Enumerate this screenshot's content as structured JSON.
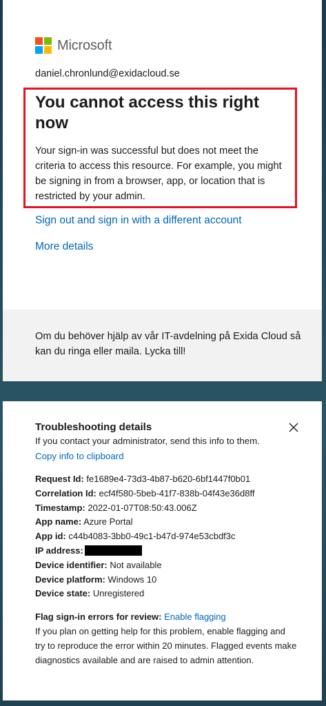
{
  "brand": {
    "name": "Microsoft",
    "colors": [
      "#f25022",
      "#7fba00",
      "#00a4ef",
      "#ffb900"
    ]
  },
  "signin": {
    "email": "daniel.chronlund@exidacloud.se",
    "title": "You cannot access this right now",
    "description": "Your sign-in was successful but does not meet the criteria to access this resource. For example, you might be signing in from a browser, app, or location that is restricted by your admin.",
    "signout_link": "Sign out and sign in with a different account",
    "more_details_link": "More details",
    "footer_text": "Om du behöver hjälp av vår IT-avdelning på Exida Cloud så kan du ringa eller maila. Lycka till!",
    "highlight_color": "#e81123"
  },
  "troubleshooting": {
    "title": "Troubleshooting details",
    "subtitle": "If you contact your administrator, send this info to them.",
    "copy_link": "Copy info to clipboard",
    "close_icon": "close-icon",
    "fields": {
      "request_id_label": "Request Id:",
      "request_id": "fe1689e4-73d3-4b87-b620-6bf1447f0b01",
      "correlation_id_label": "Correlation Id:",
      "correlation_id": "ecf4f580-5beb-41f7-838b-04f43e36d8ff",
      "timestamp_label": "Timestamp:",
      "timestamp": "2022-01-07T08:50:43.006Z",
      "app_name_label": "App name:",
      "app_name": "Azure Portal",
      "app_id_label": "App id:",
      "app_id": "c44b4083-3bb0-49c1-b47d-974e53cbdf3c",
      "ip_address_label": "IP address:",
      "device_identifier_label": "Device identifier:",
      "device_identifier": "Not available",
      "device_platform_label": "Device platform:",
      "device_platform": "Windows 10",
      "device_state_label": "Device state:",
      "device_state": "Unregistered"
    },
    "flag_label": "Flag sign-in errors for review:",
    "flag_link": "Enable flagging",
    "flag_text": "If you plan on getting help for this problem, enable flagging and try to reproduce the error within 20 minutes. Flagged events make diagnostics available and are raised to admin attention."
  }
}
